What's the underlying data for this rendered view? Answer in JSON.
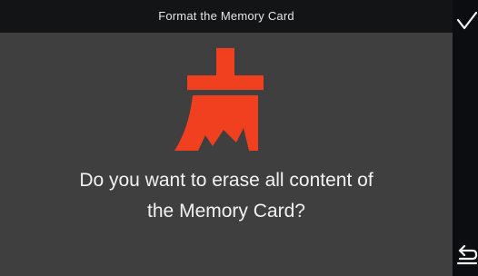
{
  "dialog": {
    "title": "Format the Memory Card",
    "message_line1": "Do you want to erase all content of",
    "message_line2": "the Memory Card?"
  },
  "icons": {
    "main": "broom-icon",
    "confirm": "checkmark-icon",
    "back": "return-arrow-icon"
  },
  "colors": {
    "accent": "#f0401f",
    "background": "#3f3f3f",
    "title_bar": "#121416",
    "rail": "#0b0d10",
    "text": "#f2f2f2"
  }
}
